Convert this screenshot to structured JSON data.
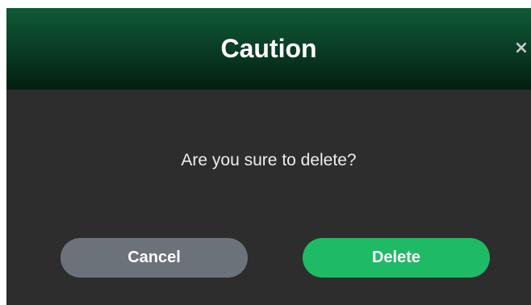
{
  "dialog": {
    "title": "Caution",
    "close_label": "×",
    "message": "Are you sure to delete?",
    "buttons": {
      "cancel_label": "Cancel",
      "delete_label": "Delete"
    }
  },
  "colors": {
    "header_gradient_top": "#0f5a36",
    "header_gradient_bottom": "#031e10",
    "body_background": "#2d2d2d",
    "cancel_button": "#6c727a",
    "delete_button": "#1fba66"
  }
}
